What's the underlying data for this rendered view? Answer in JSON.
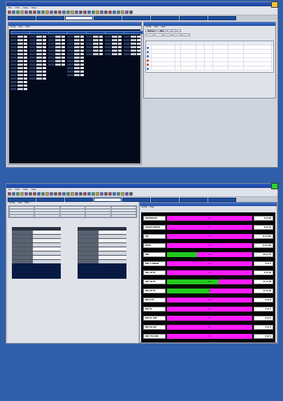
{
  "colors": {
    "desktop": "#2e5fa8",
    "title_bar": "#1f4aa6",
    "progress_fill": "#22c91e",
    "progress_track": "#ff1cff",
    "corner_badge": "#2fd12f"
  },
  "window1": {
    "menu": [
      "File",
      "Edit",
      "View",
      "Help"
    ],
    "tabs": [
      "",
      "",
      "",
      "",
      "",
      "",
      "",
      ""
    ],
    "active_tab": 2,
    "left_pane": {
      "menu": [
        "Config",
        "View",
        "Help"
      ],
      "columns": [
        "",
        "",
        "",
        "",
        "",
        "",
        ""
      ]
    },
    "right_pane": {
      "menu": [
        "Config",
        "View",
        "Help"
      ],
      "tabs": [
        "Refresh",
        "Next",
        "",
        "",
        ""
      ],
      "list_tabs": [
        "",
        "",
        "",
        "",
        ""
      ],
      "headers": [
        "",
        "",
        "",
        "",
        "",
        "",
        "",
        "",
        ""
      ],
      "rows": [
        {
          "dot": "#2a59c7",
          "cells": [
            "",
            "",
            "",
            "",
            "",
            "",
            "",
            ""
          ]
        },
        {
          "dot": "#2a59c7",
          "cells": [
            "",
            "",
            "",
            "",
            "",
            "",
            "",
            ""
          ]
        },
        {
          "dot": "#2a59c7",
          "cells": [
            "",
            "",
            "",
            "",
            "",
            "",
            "",
            ""
          ]
        },
        {
          "dot": "#d22",
          "cells": [
            "",
            "",
            "",
            "",
            "",
            "",
            "",
            ""
          ]
        },
        {
          "dot": "#d22",
          "cells": [
            "",
            "",
            "",
            "",
            "",
            "",
            "",
            ""
          ]
        },
        {
          "dot": "#2a59c7",
          "cells": [
            "",
            "",
            "",
            "",
            "",
            "",
            "",
            ""
          ]
        }
      ]
    }
  },
  "window2": {
    "menu": [
      "File",
      "Edit",
      "View",
      "Help"
    ],
    "tabs": [
      "",
      "",
      "",
      "",
      "",
      "",
      "",
      ""
    ],
    "active_tab": 3,
    "left_panel": {
      "menu": [
        "Config",
        "View",
        "Help"
      ],
      "bus_titles": [
        "",
        ""
      ]
    },
    "right_panel": {
      "menu": [
        "Config",
        "Help"
      ],
      "progress": [
        {
          "label": "MACRSCOH",
          "fraction": 0.0,
          "pct": "0%",
          "count": "0 of 98"
        },
        {
          "label": "PULSE POINTS",
          "fraction": 0.0,
          "pct": "0%",
          "count": "0 of 14"
        },
        {
          "label": "UB",
          "fraction": 0.0,
          "pct": "0%",
          "count": "0 of 156"
        },
        {
          "label": "OPTO",
          "fraction": 0.0,
          "pct": "0%",
          "count": "0 of 216"
        },
        {
          "label": "DIO",
          "fraction": 0.35,
          "pct": "35%",
          "count": "26 of 75"
        },
        {
          "label": "DRT 1 DSR2B",
          "fraction": 0.0,
          "pct": "0%",
          "count": "0 of 1"
        },
        {
          "label": "DIO 10 FS",
          "fraction": 0.0,
          "pct": "0%",
          "count": "0 of 10"
        },
        {
          "label": "DIO 30 FS",
          "fraction": 0.61,
          "pct": "61%",
          "count": "11 of 18"
        },
        {
          "label": "DIO 56 FS",
          "fraction": 0.5,
          "pct": "50%",
          "count": "14 of 28"
        },
        {
          "label": "DIO 8 FS",
          "fraction": 0.0,
          "pct": "0%",
          "count": "0 of 8"
        },
        {
          "label": "DIO 81",
          "fraction": 0.0,
          "pct": "0%",
          "count": "0 of 7"
        },
        {
          "label": "DIO 81 OSE",
          "fraction": 0.0,
          "pct": "0%",
          "count": "0 of 6"
        },
        {
          "label": "DIO 99 ALF",
          "fraction": 0.0,
          "pct": "0%",
          "count": "0 of 4"
        },
        {
          "label": "DIO 751 ANS",
          "fraction": 0.0,
          "pct": "0%",
          "count": "0 of 4"
        }
      ]
    }
  }
}
